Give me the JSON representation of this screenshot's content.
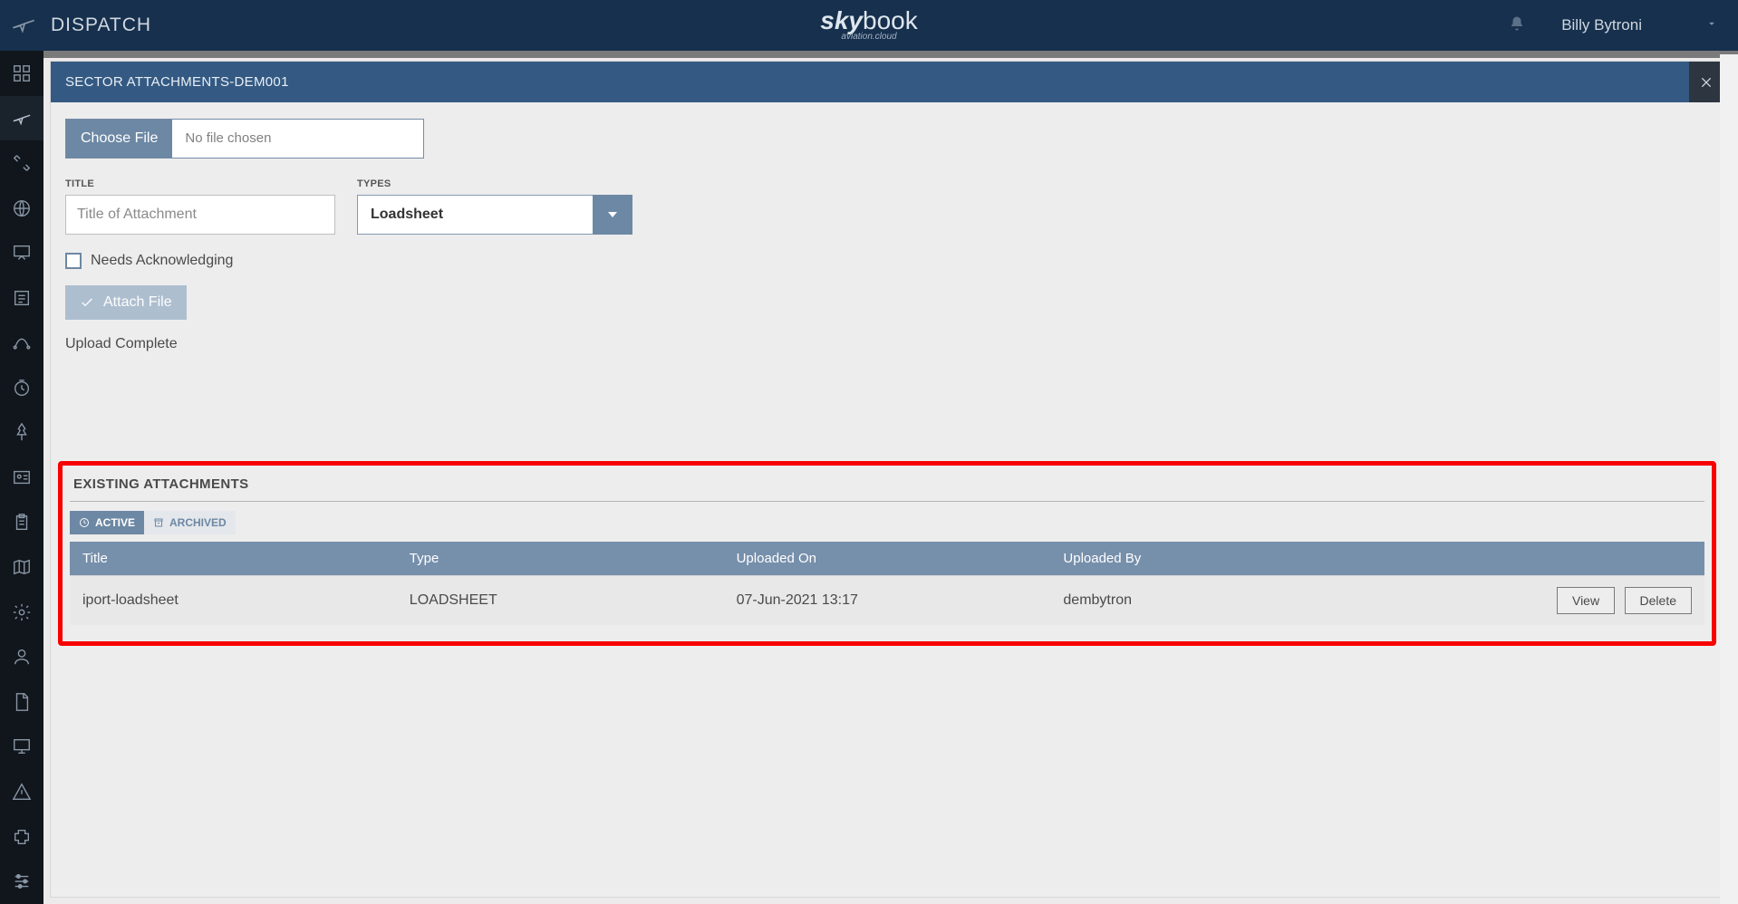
{
  "topbar": {
    "title": "DISPATCH",
    "brand_main_a": "sky",
    "brand_main_b": "book",
    "brand_sub": "aviation.cloud",
    "user_name": "Billy Bytroni"
  },
  "sidebar": {
    "icons": [
      "grid-icon",
      "plane-icon",
      "scissors-icon",
      "globe-icon",
      "presentation-icon",
      "list-icon",
      "route-icon",
      "clock-icon",
      "pin-icon",
      "id-card-icon",
      "clipboard-icon",
      "map-icon",
      "settings-icon",
      "user-icon",
      "file-icon",
      "monitor-icon",
      "warning-icon",
      "puzzle-icon",
      "sliders-icon"
    ],
    "active_index": 1
  },
  "modal": {
    "title_prefix": "SECTOR ATTACHMENTS",
    "title_sep": " - ",
    "title_id": "DEM001",
    "choose_label": "Choose File",
    "chosen_text": "No file chosen",
    "fields": {
      "title_label": "TITLE",
      "title_placeholder": "Title of Attachment",
      "title_value": "",
      "types_label": "TYPES",
      "types_value": "Loadsheet"
    },
    "needs_ack_label": "Needs Acknowledging",
    "attach_label": "Attach File",
    "status_text": "Upload Complete"
  },
  "existing": {
    "section_title": "EXISTING ATTACHMENTS",
    "tabs": {
      "active": "ACTIVE",
      "archived": "ARCHIVED"
    },
    "columns": [
      "Title",
      "Type",
      "Uploaded On",
      "Uploaded By",
      ""
    ],
    "rows": [
      {
        "title": "iport-loadsheet",
        "type": "LOADSHEET",
        "uploaded_on": "07-Jun-2021 13:17",
        "uploaded_by": "dembytron"
      }
    ],
    "actions": {
      "view": "View",
      "delete": "Delete"
    }
  }
}
